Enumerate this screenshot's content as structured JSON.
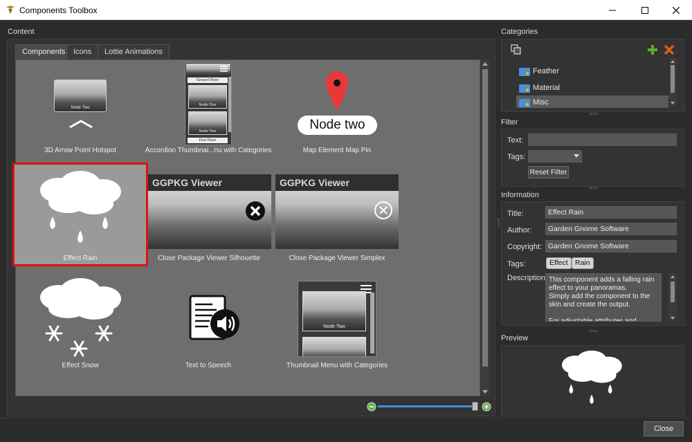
{
  "window": {
    "title": "Components Toolbox",
    "icon": "app-logo-icon"
  },
  "content": {
    "label": "Content",
    "tabs": [
      {
        "label": "Components",
        "active": true
      },
      {
        "label": "Icons",
        "active": false
      },
      {
        "label": "Lottie Animations",
        "active": false
      }
    ],
    "items": [
      {
        "label": "3D Arrow Point Hotspot"
      },
      {
        "label": "Accordion Thumbnai...nu with Categories"
      },
      {
        "label": "Map Element Map Pin"
      },
      {
        "label": "Effect Rain",
        "selected": true
      },
      {
        "label": "Close Package Viewer Silhouette"
      },
      {
        "label": "Close Package Viewer Simplex"
      },
      {
        "label": "Effect Snow"
      },
      {
        "label": "Text to Speech"
      },
      {
        "label": "Thumbnail Menu with Categories"
      }
    ],
    "thumb_texts": {
      "node_two": "Node Two",
      "ground_floor": "Ground Floor",
      "node_one": "Node One",
      "first_floor": "First Floor",
      "map_pin_label": "Node two",
      "ggpkg_viewer": "GGPKG Viewer"
    }
  },
  "categories": {
    "label": "Categories",
    "items": [
      {
        "label": "Feather"
      },
      {
        "label": "Material"
      },
      {
        "label": "Misc",
        "selected": true
      }
    ]
  },
  "filter": {
    "label": "Filter",
    "text_label": "Text:",
    "text_value": "",
    "tags_label": "Tags:",
    "tags_value": "",
    "reset_label": "Reset Filter"
  },
  "information": {
    "label": "Information",
    "title_label": "Title:",
    "title_value": "Effect Rain",
    "author_label": "Author:",
    "author_value": "Garden Gnome Software",
    "copyright_label": "Copyright:",
    "copyright_value": "Garden Gnome Software",
    "tags_label": "Tags:",
    "tags": [
      "Effect",
      "Rain"
    ],
    "description_label": "Description:",
    "description": "This component adds a falling rain effect to your panoramas.\nSimply add the component to the skin and create the output.\n\nFor adjustable attributes and actions"
  },
  "preview": {
    "label": "Preview"
  },
  "footer": {
    "close_label": "Close"
  },
  "colors": {
    "selection_border": "#e01010",
    "map_pin": "#e8383a",
    "add_icon": "#5ab030",
    "delete_icon": "#e05a10",
    "zoom_track": "#3d8ee0"
  }
}
